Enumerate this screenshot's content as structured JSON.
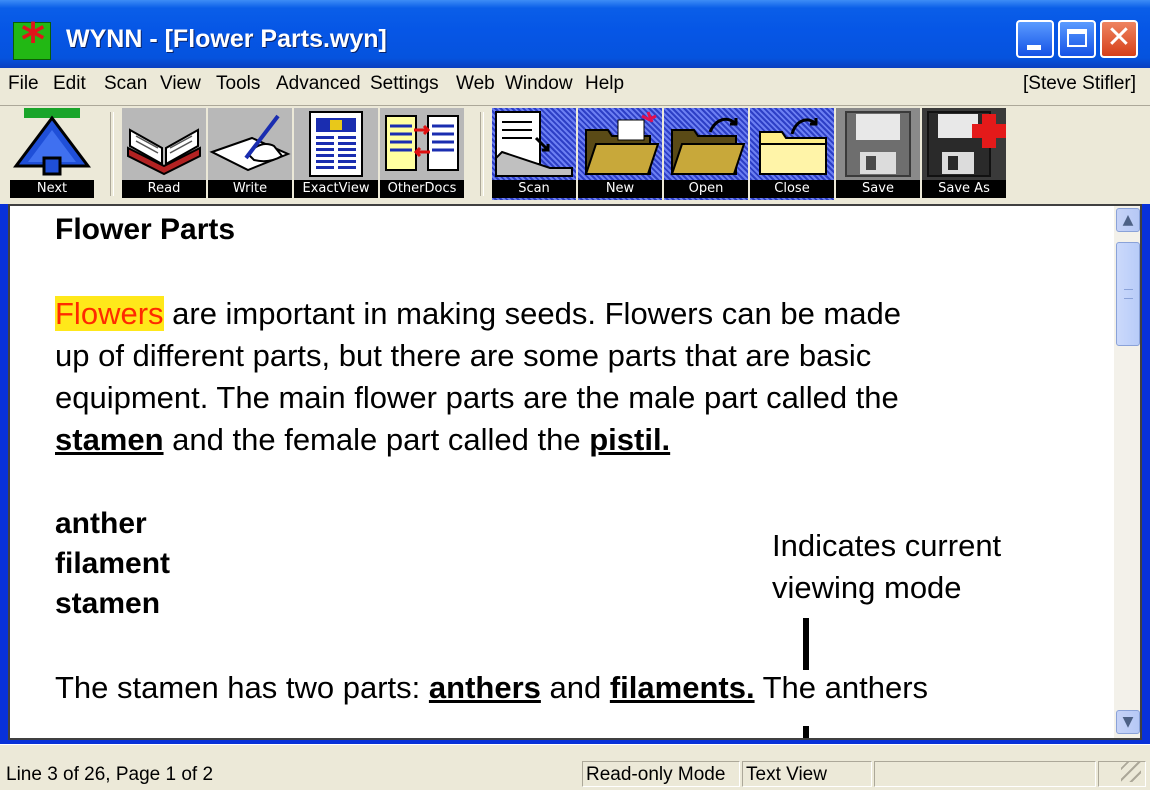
{
  "window": {
    "title": "WYNN - [Flower Parts.wyn]",
    "close_glyph": "✕"
  },
  "menu": {
    "items": [
      "File",
      "Edit",
      "Scan",
      "View",
      "Tools",
      "Advanced",
      "Settings",
      "Web",
      "Window",
      "Help"
    ],
    "user": "[Steve Stifler]"
  },
  "toolbar": {
    "buttons": [
      {
        "label": "Next",
        "icon": "next-arrow-icon"
      },
      {
        "label": "Read",
        "icon": "open-book-icon"
      },
      {
        "label": "Write",
        "icon": "writing-hand-icon"
      },
      {
        "label": "ExactView",
        "icon": "exact-view-icon"
      },
      {
        "label": "OtherDocs",
        "icon": "other-docs-icon"
      },
      {
        "label": "Scan",
        "icon": "scanner-icon"
      },
      {
        "label": "New",
        "icon": "new-folder-icon"
      },
      {
        "label": "Open",
        "icon": "open-folder-icon"
      },
      {
        "label": "Close",
        "icon": "close-folder-icon"
      },
      {
        "label": "Save",
        "icon": "save-disk-icon"
      },
      {
        "label": "Save As",
        "icon": "save-as-disk-icon"
      }
    ]
  },
  "document": {
    "heading": "Flower Parts",
    "para1": {
      "highlight": "Flowers",
      "line1_rest": " are important in making seeds. Flowers can be made",
      "line2": "up of different parts, but there are some parts that are basic",
      "line3": "equipment. The main flower parts are the male part called the",
      "line4_term1": "stamen",
      "line4_mid": " and the female part called the ",
      "line4_term2": "pistil."
    },
    "terms": [
      "anther",
      "filament",
      "stamen"
    ],
    "para2": {
      "start": "The stamen has two parts: ",
      "term1": "anthers",
      "mid": " and ",
      "term2": "filaments.",
      "end": " The anthers"
    }
  },
  "annotation": {
    "line1": "Indicates current",
    "line2": "viewing mode"
  },
  "status": {
    "position": "Line 3 of 26, Page 1 of 2",
    "mode": "Read-only Mode",
    "view": "Text View"
  },
  "colors": {
    "title_bar": "#0a5ee8",
    "highlight_bg": "#ffe81a",
    "highlight_text": "#ff2a00"
  }
}
